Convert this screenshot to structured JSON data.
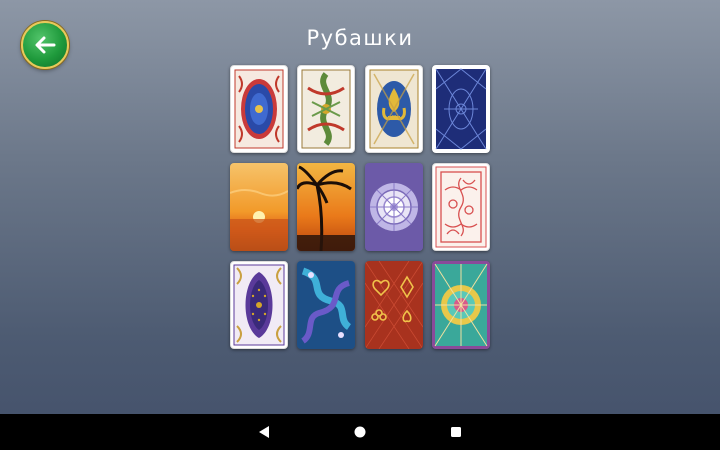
{
  "header": {
    "title": "Рубашки",
    "back_icon": "arrow-left-icon"
  },
  "card_backs": [
    {
      "design": "blue-floral-ornament",
      "accent": "#2a4aa8"
    },
    {
      "design": "green-dragon-ornament",
      "accent": "#5d8a3a"
    },
    {
      "design": "gold-fleur-de-lis",
      "accent": "#2d5aa8"
    },
    {
      "design": "classic-blue-pattern",
      "accent": "#1e2d78"
    },
    {
      "design": "sunset-sea",
      "accent": "#f08a1e"
    },
    {
      "design": "palm-tree-sunset",
      "accent": "#e8731a"
    },
    {
      "design": "purple-mandala",
      "accent": "#7a6ab8"
    },
    {
      "design": "red-floral-line-art",
      "accent": "#d85050"
    },
    {
      "design": "purple-medallion",
      "accent": "#5a3a9a"
    },
    {
      "design": "blue-dragons",
      "accent": "#2a8ab8"
    },
    {
      "design": "red-card-suits",
      "accent": "#b83a2a"
    },
    {
      "design": "teal-kaleidoscope",
      "accent": "#3aa89a"
    }
  ],
  "system_nav": {
    "back_icon": "nav-back-icon",
    "home_icon": "nav-home-icon",
    "recents_icon": "nav-recents-icon"
  }
}
